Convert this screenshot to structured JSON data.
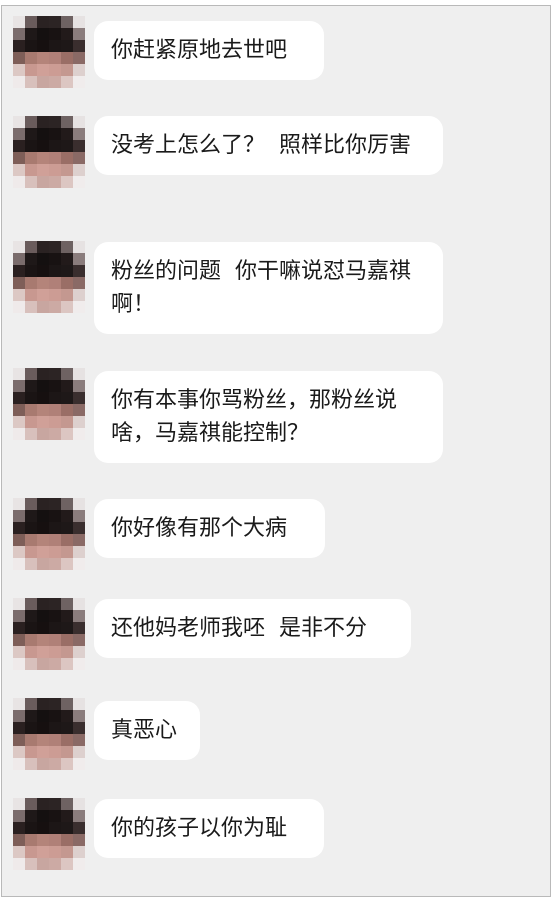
{
  "chat": {
    "messages": [
      {
        "text": "你赶紧原地去世吧"
      },
      {
        "text": "没考上怎么了？  照样比你厉害"
      },
      {
        "text": "粉丝的问题  你干嘛说怼马嘉祺啊！"
      },
      {
        "text": "你有本事你骂粉丝，那粉丝说啥，马嘉祺能控制？"
      },
      {
        "text": "你好像有那个大病"
      },
      {
        "text": "还他妈老师我呸  是非不分"
      },
      {
        "text": "真恶心"
      },
      {
        "text": "你的孩子以你为耻"
      }
    ]
  },
  "colors": {
    "background": "#efefef",
    "bubble": "#ffffff",
    "text": "#1a1a1a"
  },
  "avatar_icon": "pixelated-avatar"
}
